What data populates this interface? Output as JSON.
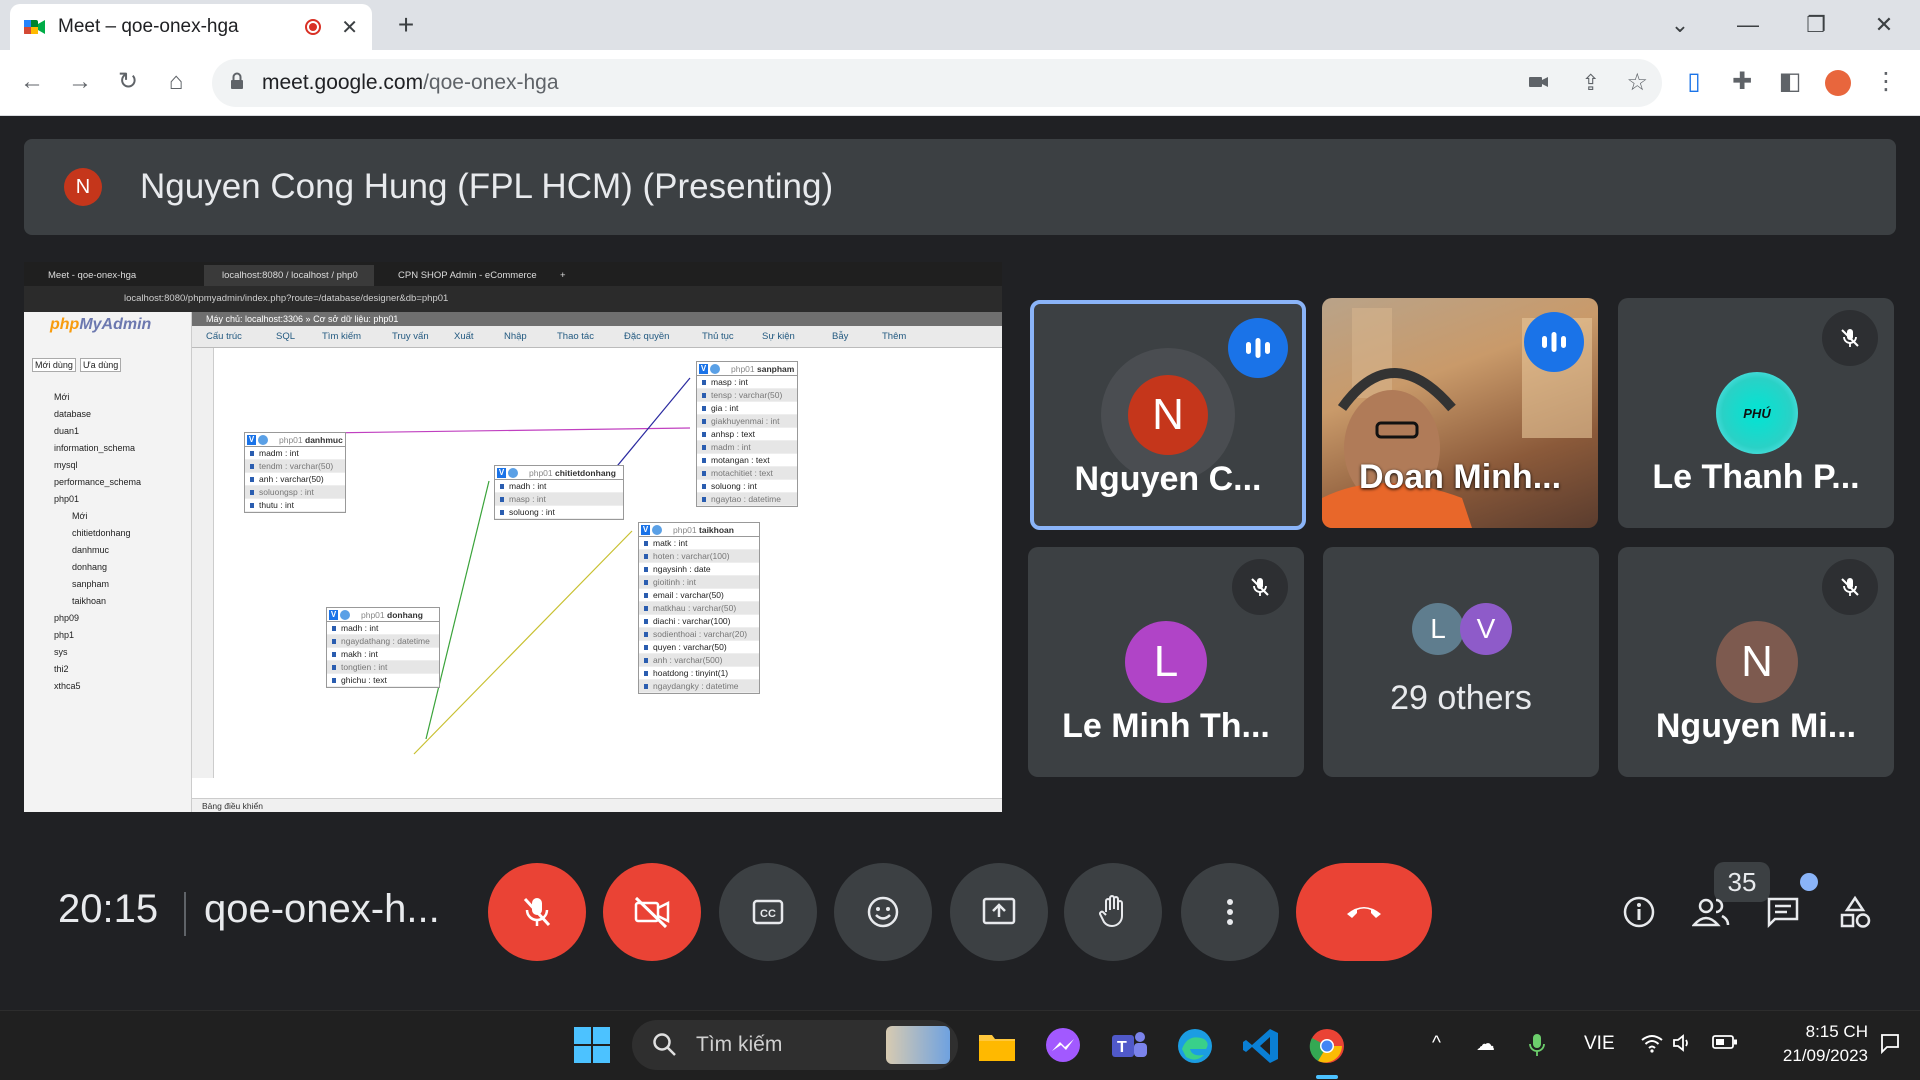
{
  "browser": {
    "tab_title": "Meet – qoe-onex-hga",
    "url_host": "meet.google.com",
    "url_path": "/qoe-onex-hga"
  },
  "presenter": {
    "initial": "N",
    "label": "Nguyen Cong Hung (FPL HCM) (Presenting)",
    "avatar_color": "#c5361b"
  },
  "shared_screen": {
    "tabs": [
      "Meet - qoe-onex-hga",
      "localhost:8080 / localhost / php0",
      "CPN SHOP Admin - eCommerce"
    ],
    "url": "localhost:8080/phpmyadmin/index.php?route=/database/designer&db=php01",
    "pma": {
      "logo_a": "php",
      "logo_b": "MyAdmin",
      "recent": "Mới dùng",
      "favorites": "Ưa dùng",
      "breadcrumb": "Máy chủ: localhost:3306 » Cơ sở dữ liệu: php01",
      "tree": [
        "Mới",
        "database",
        "duan1",
        "information_schema",
        "mysql",
        "performance_schema",
        "php01",
        "Mới",
        "chitietdonhang",
        "danhmuc",
        "donhang",
        "sanpham",
        "taikhoan",
        "php09",
        "php1",
        "sys",
        "thi2",
        "xthca5"
      ],
      "menu": [
        "Cấu trúc",
        "SQL",
        "Tìm kiếm",
        "Truy vấn",
        "Xuất",
        "Nhập",
        "Thao tác",
        "Đặc quyền",
        "Thủ tục",
        "Sự kiện",
        "Bẫy",
        "Thêm"
      ],
      "console": "Bảng điều khiển",
      "tables": {
        "danhmuc": {
          "db": "php01",
          "name": "danhmuc",
          "cols": [
            "madm : int",
            "tendm : varchar(50)",
            "anh : varchar(50)",
            "soluongsp : int",
            "thutu : int"
          ]
        },
        "chitietdonhang": {
          "db": "php01",
          "name": "chitietdonhang",
          "cols": [
            "madh : int",
            "masp : int",
            "soluong : int"
          ]
        },
        "sanpham": {
          "db": "php01",
          "name": "sanpham",
          "cols": [
            "masp : int",
            "tensp : varchar(50)",
            "gia : int",
            "giakhuyenmai : int",
            "anhsp : text",
            "madm : int",
            "motangan : text",
            "motachitiet : text",
            "soluong : int",
            "ngaytao : datetime"
          ]
        },
        "taikhoan": {
          "db": "php01",
          "name": "taikhoan",
          "cols": [
            "matk : int",
            "hoten : varchar(100)",
            "ngaysinh : date",
            "gioitinh : int",
            "email : varchar(50)",
            "matkhau : varchar(50)",
            "diachi : varchar(100)",
            "sodienthoai : varchar(20)",
            "quyen : varchar(50)",
            "anh : varchar(500)",
            "hoatdong : tinyint(1)",
            "ngaydangky : datetime"
          ]
        },
        "donhang": {
          "db": "php01",
          "name": "donhang",
          "cols": [
            "madh : int",
            "ngaydathang : datetime",
            "makh : int",
            "tongtien : int",
            "ghichu : text"
          ]
        }
      }
    }
  },
  "participants": [
    {
      "name": "Nguyen C...",
      "initial": "N",
      "color": "#c5361b",
      "state": "talking",
      "pinned": true
    },
    {
      "name": "Doan Minh...",
      "state": "talking",
      "video": true
    },
    {
      "name": "Le Thanh P...",
      "initial": "PHÚ",
      "state": "muted"
    },
    {
      "name": "Le Minh Th...",
      "initial": "L",
      "color": "#b044c7",
      "state": "muted"
    },
    {
      "name": "29 others",
      "initials": [
        "L",
        "V"
      ],
      "colors": [
        "#5f7d8e",
        "#8e5bc9"
      ]
    },
    {
      "name": "Nguyen Mi...",
      "initial": "N",
      "color": "#7d5a4f",
      "state": "muted"
    }
  ],
  "bottom_bar": {
    "time": "20:15",
    "meeting_code": "qoe-onex-h...",
    "people_count": "35"
  },
  "taskbar": {
    "search": "Tìm kiếm",
    "language": "VIE",
    "time": "8:15 CH",
    "date": "21/09/2023"
  }
}
